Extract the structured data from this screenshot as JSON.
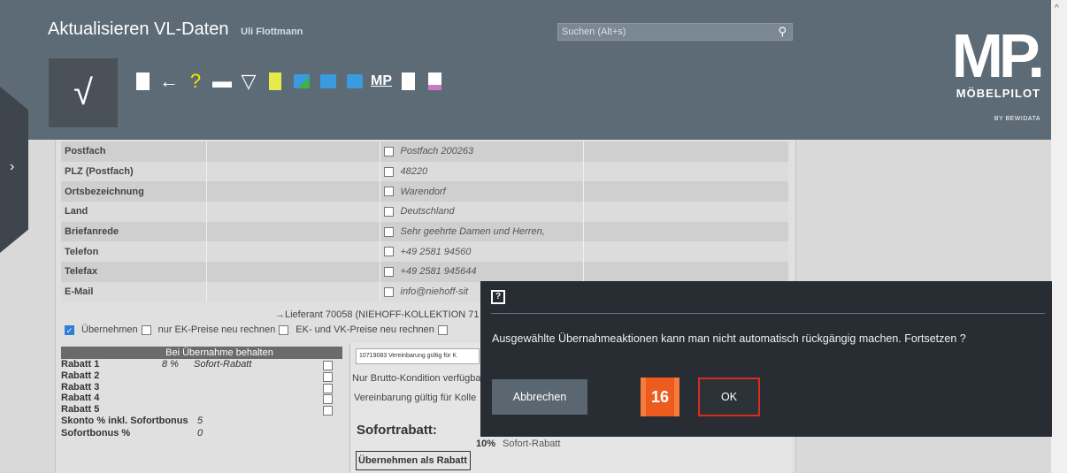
{
  "header": {
    "title": "Aktualisieren VL-Daten",
    "user": "Uli Flottmann",
    "search_placeholder": "Suchen (Alt+s)",
    "logo_big": "MP.",
    "logo_name": "MÖBELPILOT",
    "logo_by": "BY BEWIDATA",
    "confirm_glyph": "√",
    "toolbar_mp": "MP"
  },
  "attributes": [
    {
      "label": "Postfach",
      "value": "Postfach 200263"
    },
    {
      "label": "PLZ (Postfach)",
      "value": "48220"
    },
    {
      "label": "Ortsbezeichnung",
      "value": "Warendorf"
    },
    {
      "label": "Land",
      "value": "Deutschland"
    },
    {
      "label": "Briefanrede",
      "value": "Sehr geehrte Damen und Herren,"
    },
    {
      "label": "Telefon",
      "value": "+49 2581 94560"
    },
    {
      "label": "Telefax",
      "value": "+49 2581 945644"
    },
    {
      "label": "E-Mail",
      "value": "info@niehoff-sit"
    }
  ],
  "lieferant": "→Lieferant 70058 (NIEHOFF-KOLLEKTION 71",
  "options": {
    "uebernehmen": "Übernehmen",
    "ek_preise": "nur EK-Preise neu rechnen",
    "ek_vk_preise": "EK- und VK-Preise neu rechnen"
  },
  "discounts": {
    "header": "Bei Übernahme behalten",
    "rows": [
      {
        "label": "Rabatt 1",
        "pct": "8 %",
        "name": "Sofort-Rabatt"
      },
      {
        "label": "Rabatt 2",
        "pct": "",
        "name": ""
      },
      {
        "label": "Rabatt 3",
        "pct": "",
        "name": ""
      },
      {
        "label": "Rabatt 4",
        "pct": "",
        "name": ""
      },
      {
        "label": "Rabatt 5",
        "pct": "",
        "name": ""
      }
    ],
    "skonto_label": "Skonto % inkl. Sofortbonus",
    "skonto_value": "5",
    "sofortbonus_label": "Sofortbonus %",
    "sofortbonus_value": "0"
  },
  "detail": {
    "select_value": "10719083 Vereinbarung gültig für K",
    "line1": "Nur Brutto-Kondition verfügba",
    "line2": "Vereinbarung gültig für Kolle",
    "sofortrabatt": "Sofortrabatt:",
    "pct": "10%",
    "pct_name": "Sofort-Rabatt",
    "uebernehmen_als": "Übernehmen als Rabatt"
  },
  "dialog": {
    "icon": "?",
    "message": "Ausgewählte Übernahmeaktionen kann man nicht automatisch rückgängig machen. Fortsetzen ?",
    "cancel_label": "Abbrechen",
    "ok_label": "OK",
    "step_badge": "16"
  }
}
